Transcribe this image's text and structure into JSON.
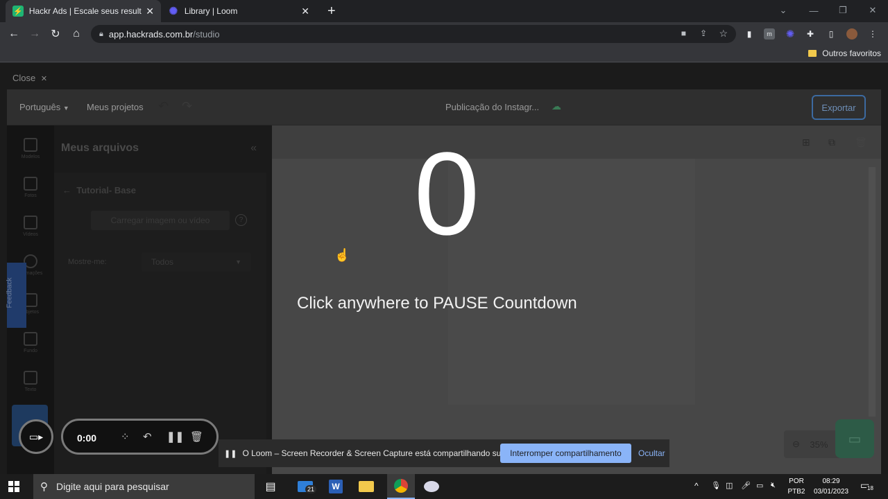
{
  "browser": {
    "tabs": [
      {
        "title": "Hackr Ads | Escale seus resultado",
        "favicon": "hackrads-bolt-icon",
        "active": true
      },
      {
        "title": "Library | Loom",
        "favicon": "loom-icon",
        "active": false
      }
    ],
    "new_tab": "+",
    "url_host": "app.hackrads.com.br",
    "url_path": "/studio",
    "bookmark_folder": "Outros favoritos"
  },
  "page": {
    "close_label": "Close",
    "header": {
      "language": "Português",
      "projects": "Meus projetos",
      "project_name": "Publicação do Instagr...",
      "export": "Exportar"
    },
    "rail": [
      "Modelos",
      "Fotos",
      "Vídeos",
      "Animações",
      "Objetos",
      "Fundo",
      "Texto"
    ],
    "panel": {
      "title": "Meus arquivos",
      "folder": "Tutorial- Base",
      "upload": "Carregar imagem ou vídeo",
      "help": "?",
      "show_label": "Mostre-me:",
      "show_value": "Todos"
    },
    "feedback": "Feedback",
    "zoom": "35%"
  },
  "countdown": {
    "number": "0",
    "message": "Click anywhere to PAUSE Countdown"
  },
  "loom": {
    "timer": "0:00",
    "banner_text": "O Loom – Screen Recorder & Screen Capture está compartilhando sua tela.",
    "stop_sharing": "Interromper compartilhamento",
    "hide": "Ocultar"
  },
  "taskbar": {
    "search_placeholder": "Digite aqui para pesquisar",
    "mail_badge": "21",
    "language_1": "POR",
    "language_2": "PTB2",
    "time": "08:29",
    "date": "03/01/2023",
    "notifications": "18"
  },
  "colors": {
    "hackr_favicon": "#1fb573",
    "loom_favicon": "#625df5",
    "export_border": "#3c6aa0",
    "stop_button": "#8ab4f8"
  }
}
